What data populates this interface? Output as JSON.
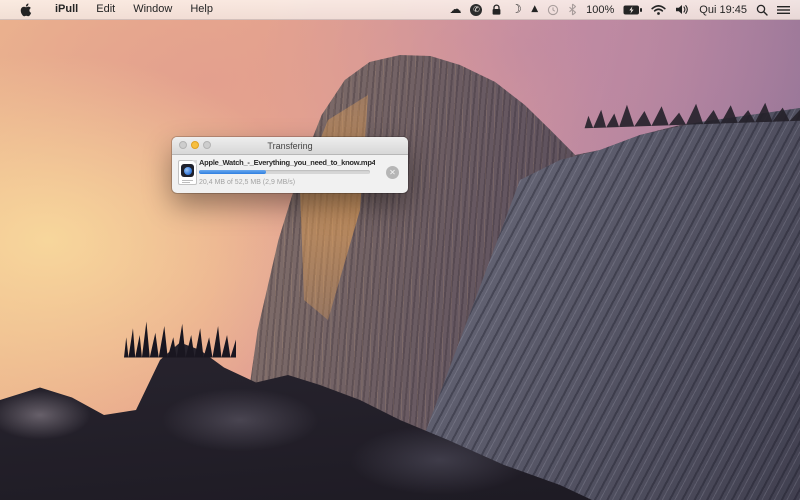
{
  "menu_bar": {
    "app_menu": {
      "items": [
        {
          "label": "iPull"
        },
        {
          "label": "Edit"
        },
        {
          "label": "Window"
        },
        {
          "label": "Help"
        }
      ]
    },
    "status_area": {
      "battery_percent": "100%",
      "clock": "Qui 19:45",
      "icon_names": [
        "cloud",
        "phone-circle",
        "padlock",
        "moon",
        "drive-triangle",
        "time-machine-clock",
        "bluetooth",
        "battery-charging",
        "wifi",
        "volume",
        "spotlight-search",
        "notification-center"
      ]
    }
  },
  "transfer_window": {
    "title": "Transfering",
    "traffic_lights": [
      "close-disabled",
      "minimize",
      "zoom-disabled"
    ],
    "file": {
      "name": "Apple_Watch_-_Everything_you_need_to_know.mp4",
      "progress_percent": 39,
      "status": "20,4 MB of 52,5 MB (2,9 MB/s)",
      "cancel_glyph": "✕"
    }
  },
  "glyphs": {
    "cloud": "☁",
    "phone": "✆",
    "moon": "☾",
    "drive": "▲"
  },
  "colors": {
    "progress_blue": "#2f7fe0",
    "traffic_yellow": "#f7bf3f",
    "menubar_bg": "#f7ece5"
  }
}
